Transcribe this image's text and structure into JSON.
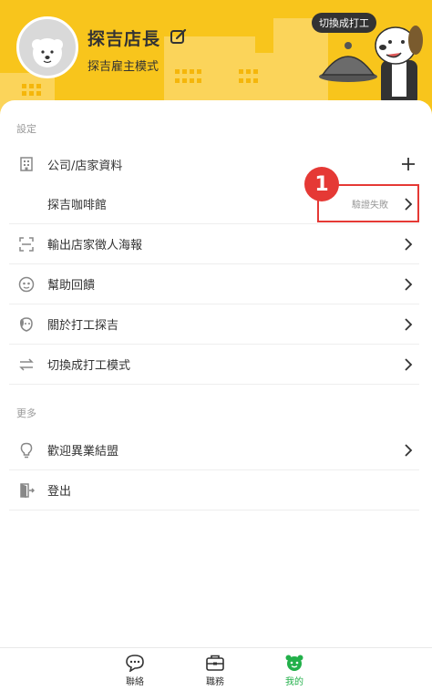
{
  "header": {
    "name": "探吉店長",
    "mode": "探吉雇主模式",
    "switch_bubble": "切換成打工"
  },
  "sections": {
    "settings_title": "設定",
    "more_title": "更多"
  },
  "settings": {
    "company_label": "公司/店家資料",
    "store_name": "探吉咖啡館",
    "store_status": "驗證失敗",
    "export_poster": "輸出店家徵人海報",
    "help_feedback": "幫助回饋",
    "about": "關於打工探吉",
    "switch_mode": "切換成打工模式"
  },
  "more": {
    "alliance": "歡迎異業結盟",
    "logout": "登出"
  },
  "annotation": {
    "marker": "1"
  },
  "nav": {
    "items": [
      {
        "label": "聯絡",
        "icon": "chat-icon"
      },
      {
        "label": "職務",
        "icon": "briefcase-icon"
      },
      {
        "label": "我的",
        "icon": "bear-face-icon",
        "active": true
      }
    ]
  },
  "colors": {
    "header_bg": "#f8c51c",
    "active_nav": "#22b04a",
    "annotation_red": "#e53935"
  }
}
